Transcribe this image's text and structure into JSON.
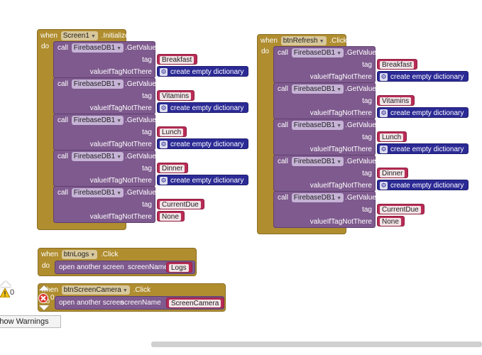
{
  "blocks": {
    "screen1_init": {
      "when": "when",
      "do": "do",
      "component": "Screen1",
      "event": ".Initialize",
      "calls": [
        {
          "call": "call",
          "component": "FirebaseDB1",
          "method": ".GetValue",
          "tag_label": "tag",
          "tag": "Breakfast",
          "value_label": "valueIfTagNotThere",
          "value": "create empty dictionary",
          "value_type": "dict"
        },
        {
          "call": "call",
          "component": "FirebaseDB1",
          "method": ".GetValue",
          "tag_label": "tag",
          "tag": "Vitamins",
          "value_label": "valueIfTagNotThere",
          "value": "create empty dictionary",
          "value_type": "dict"
        },
        {
          "call": "call",
          "component": "FirebaseDB1",
          "method": ".GetValue",
          "tag_label": "tag",
          "tag": "Lunch",
          "value_label": "valueIfTagNotThere",
          "value": "create empty dictionary",
          "value_type": "dict"
        },
        {
          "call": "call",
          "component": "FirebaseDB1",
          "method": ".GetValue",
          "tag_label": "tag",
          "tag": "Dinner",
          "value_label": "valueIfTagNotThere",
          "value": "create empty dictionary",
          "value_type": "dict"
        },
        {
          "call": "call",
          "component": "FirebaseDB1",
          "method": ".GetValue",
          "tag_label": "tag",
          "tag": "CurrentDue",
          "value_label": "valueIfTagNotThere",
          "value": "None",
          "value_type": "text"
        }
      ]
    },
    "btnrefresh_click": {
      "when": "when",
      "do": "do",
      "component": "btnRefresh",
      "event": ".Click",
      "calls": [
        {
          "call": "call",
          "component": "FirebaseDB1",
          "method": ".GetValue",
          "tag_label": "tag",
          "tag": "Breakfast",
          "value_label": "valueIfTagNotThere",
          "value": "create empty dictionary",
          "value_type": "dict"
        },
        {
          "call": "call",
          "component": "FirebaseDB1",
          "method": ".GetValue",
          "tag_label": "tag",
          "tag": "Vitamins",
          "value_label": "valueIfTagNotThere",
          "value": "create empty dictionary",
          "value_type": "dict"
        },
        {
          "call": "call",
          "component": "FirebaseDB1",
          "method": ".GetValue",
          "tag_label": "tag",
          "tag": "Lunch",
          "value_label": "valueIfTagNotThere",
          "value": "create empty dictionary",
          "value_type": "dict"
        },
        {
          "call": "call",
          "component": "FirebaseDB1",
          "method": ".GetValue",
          "tag_label": "tag",
          "tag": "Dinner",
          "value_label": "valueIfTagNotThere",
          "value": "create empty dictionary",
          "value_type": "dict"
        },
        {
          "call": "call",
          "component": "FirebaseDB1",
          "method": ".GetValue",
          "tag_label": "tag",
          "tag": "CurrentDue",
          "value_label": "valueIfTagNotThere",
          "value": "None",
          "value_type": "text"
        }
      ]
    },
    "btnlogs_click": {
      "when": "when",
      "do": "do",
      "component": "btnLogs",
      "event": ".Click",
      "action": "open another screen",
      "param_label": "screenName",
      "param": "Logs"
    },
    "btnscreencamera_click": {
      "when": "when",
      "do": "do",
      "component": "btnScreenCamera",
      "event": ".Click",
      "action": "open another screen",
      "param_label": "screenName",
      "param": "ScreenCamera"
    }
  },
  "indicators": {
    "warning_count": "0",
    "error_count": "0",
    "show_warnings": "Show Warnings",
    "warning_icon": "warning-triangle-icon",
    "error_icon": "error-x-icon"
  },
  "colors": {
    "event": "#b08d2f",
    "call": "#7e5a8e",
    "text": "#b82c55",
    "dict": "#2b2a95"
  }
}
